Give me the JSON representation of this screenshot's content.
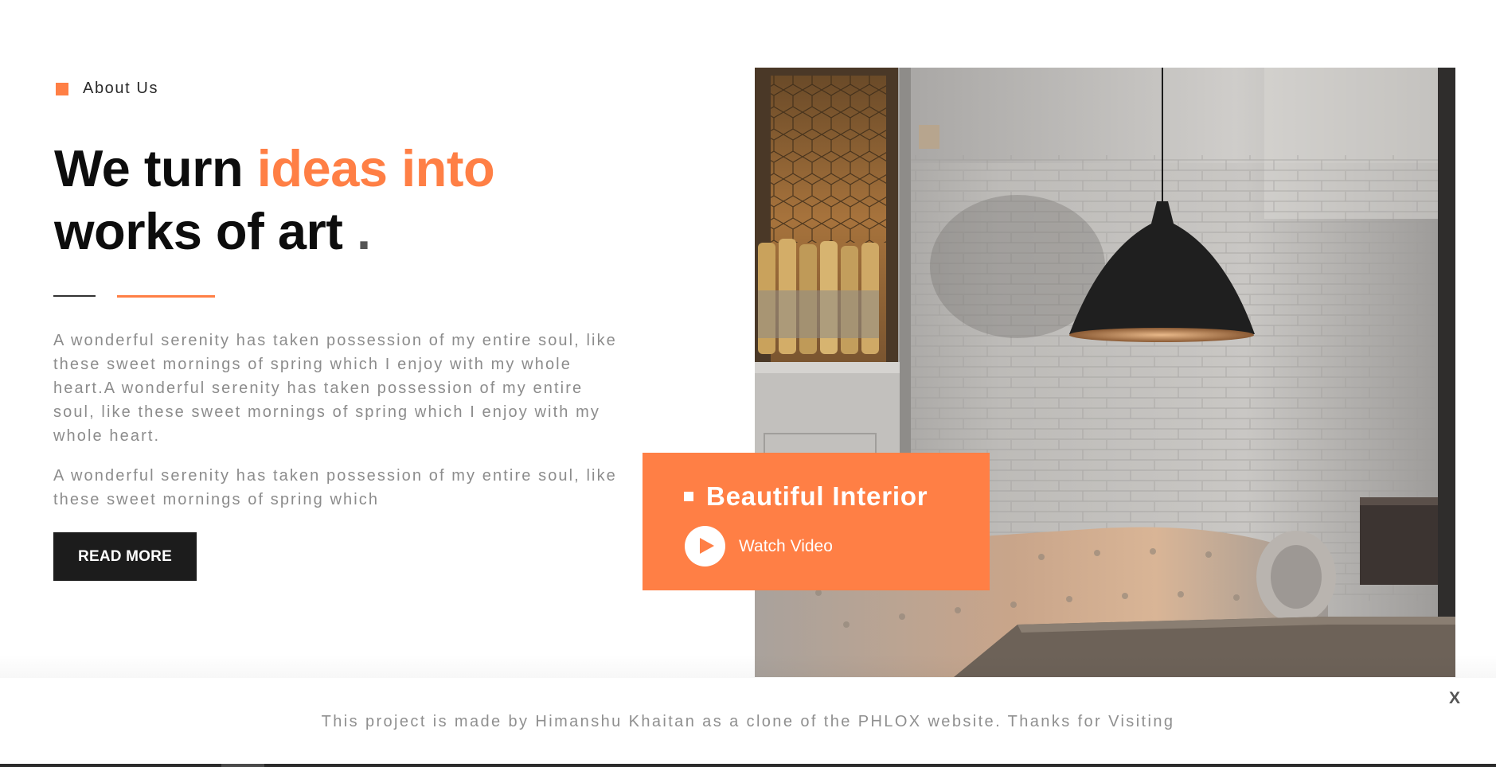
{
  "about": {
    "eyebrow": "About Us",
    "headline_part1": "We turn ",
    "headline_accent": "ideas into",
    "headline_part2": "works of art",
    "headline_dot": ".",
    "paragraph1": "A wonderful serenity has taken possession of my entire soul, like these sweet mornings of spring which I enjoy with my whole heart.A wonderful serenity has taken possession of my entire soul, like these sweet mornings of spring which I enjoy with my whole heart.",
    "paragraph2": "A wonderful serenity has taken possession of my entire soul, like these sweet mornings of spring which",
    "read_more_label": "READ MORE"
  },
  "card": {
    "title": "Beautiful Interior",
    "watch_label": "Watch Video"
  },
  "banner": {
    "text": "This project is made by Himanshu Khaitan as a clone of the PHLOX website. Thanks for Visiting",
    "close_label": "X"
  },
  "colors": {
    "accent": "#ff7f45",
    "dark": "#1c1c1c",
    "muted_text": "#8c8c8c"
  },
  "icons": {
    "eyebrow": "square-bullet-icon",
    "card": "square-bullet-icon",
    "play": "play-icon",
    "close": "close-icon"
  }
}
